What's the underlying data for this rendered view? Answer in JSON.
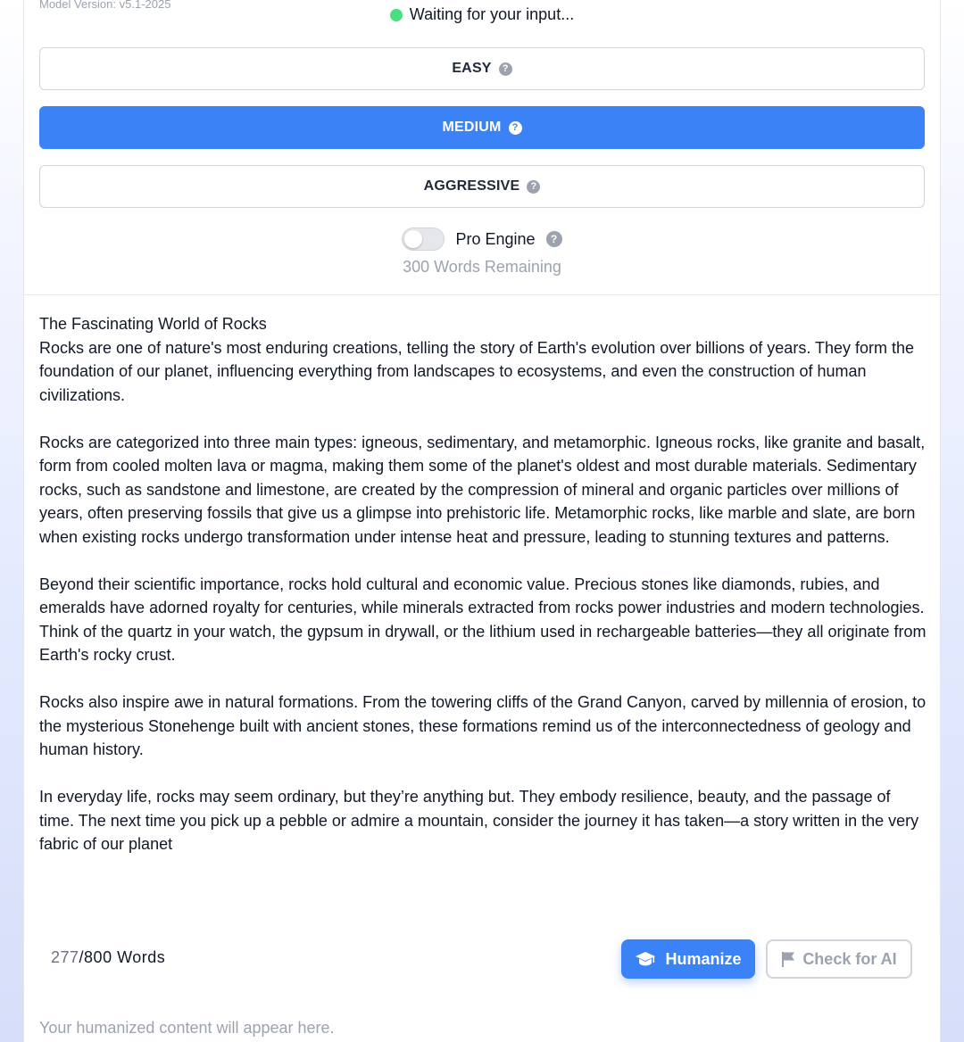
{
  "header": {
    "model_version": "Model Version: v5.1-2025",
    "status_text": "Waiting for your input..."
  },
  "modes": [
    {
      "label": "EASY",
      "active": false
    },
    {
      "label": "MEDIUM",
      "active": true
    },
    {
      "label": "AGGRESSIVE",
      "active": false
    }
  ],
  "pro_engine": {
    "label": "Pro Engine",
    "enabled": false,
    "remaining": "300 Words Remaining"
  },
  "input": {
    "paragraphs": [
      "The Fascinating World of Rocks",
      "Rocks are one of nature's most enduring creations, telling the story of Earth's evolution over billions of years. They form the foundation of our planet, influencing everything from landscapes to ecosystems, and even the construction of human civilizations.",
      "Rocks are categorized into three main types: igneous, sedimentary, and metamorphic. Igneous rocks, like granite and basalt, form from cooled molten lava or magma, making them some of the planet's oldest and most durable materials. Sedimentary rocks, such as sandstone and limestone, are created by the compression of mineral and organic particles over millions of years, often preserving fossils that give us a glimpse into prehistoric life. Metamorphic rocks, like marble and slate, are born when existing rocks undergo transformation under intense heat and pressure, leading to stunning textures and patterns.",
      "Beyond their scientific importance, rocks hold cultural and economic value. Precious stones like diamonds, rubies, and emeralds have adorned royalty for centuries, while minerals extracted from rocks power industries and modern technologies. Think of the quartz in your watch, the gypsum in drywall, or the lithium used in rechargeable batteries—they all originate from Earth's rocky crust.",
      "Rocks also inspire awe in natural formations. From the towering cliffs of the Grand Canyon, carved by millennia of erosion, to the mysterious Stonehenge built with ancient stones, these formations remind us of the interconnectedness of geology and human history.",
      "In everyday life, rocks may seem ordinary, but they’re anything but. They embody resilience, beauty, and the passage of time. The next time you pick up a pebble or admire a mountain, consider the journey it has taken—a story written in the very fabric of our planet"
    ]
  },
  "footer": {
    "word_count": "277",
    "word_limit": "/800 Words",
    "humanize_label": "Humanize",
    "check_label": "Check for AI"
  },
  "output": {
    "placeholder": "Your humanized content will appear here."
  },
  "colors": {
    "accent": "#3b82f6",
    "status_dot": "#4ade80",
    "muted": "#9ca3af"
  },
  "icons": {
    "help": "question-circle-icon",
    "humanize": "graduation-cap-icon",
    "check": "flag-icon"
  }
}
